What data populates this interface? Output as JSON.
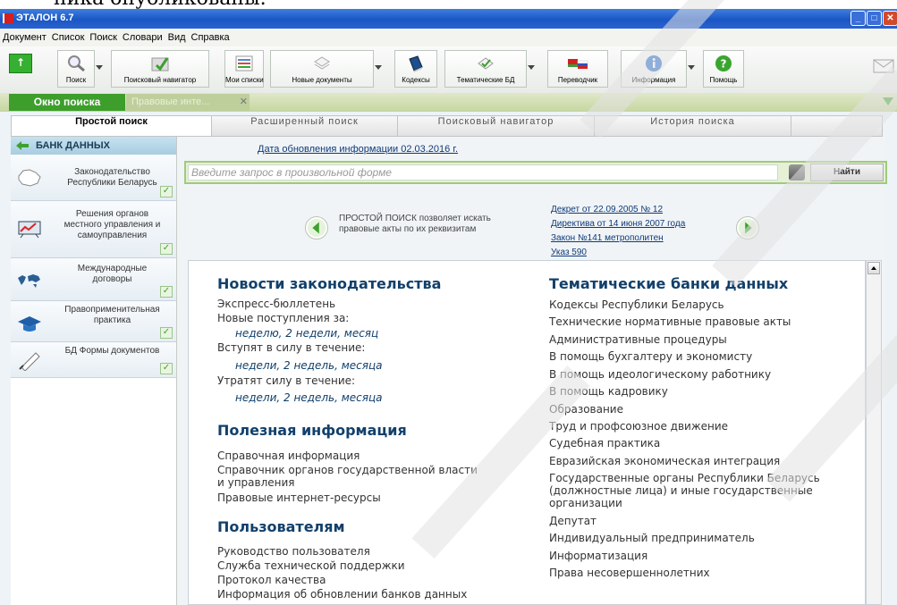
{
  "app": {
    "title": "ЭТАЛОН 6.7",
    "doc_fragment": "ника опубликованы."
  },
  "menu": [
    "Документ",
    "Список",
    "Поиск",
    "Словари",
    "Вид",
    "Справка"
  ],
  "toolbar": [
    {
      "label": "Поиск",
      "icon": "magnifier-icon",
      "dropdown": true
    },
    {
      "label": "Поисковый навигатор",
      "icon": "navigator-icon",
      "dropdown": false
    },
    {
      "label": "Мои списки",
      "icon": "lists-icon",
      "dropdown": false
    },
    {
      "label": "Новые документы",
      "icon": "new-docs-icon",
      "dropdown": true
    },
    {
      "label": "Кодексы",
      "icon": "books-icon",
      "dropdown": false
    },
    {
      "label": "Тематические БД",
      "icon": "thematic-db-icon",
      "dropdown": true
    },
    {
      "label": "Переводчик",
      "icon": "translator-flags-icon",
      "dropdown": false
    },
    {
      "label": "Информация",
      "icon": "info-icon",
      "dropdown": true
    },
    {
      "label": "Помощь",
      "icon": "help-icon",
      "dropdown": false
    }
  ],
  "tabs": {
    "active": "Окно поиска",
    "second": "Правовые инте..."
  },
  "search_tabs": [
    "Простой поиск",
    "Расширенный поиск",
    "Поисковый навигатор",
    "История поиска"
  ],
  "sidebar": {
    "header": "БАНК ДАННЫХ",
    "items": [
      {
        "label": "Законодательство Республики Беларусь",
        "icon": "belarus-map-icon"
      },
      {
        "label": "Решения органов местного управления и самоуправления",
        "icon": "board-chart-icon"
      },
      {
        "label": "Международные договоры",
        "icon": "world-map-icon"
      },
      {
        "label": "Правоприменительная практика",
        "icon": "graduation-cap-icon"
      },
      {
        "label": "БД Формы документов",
        "icon": "pen-document-icon"
      }
    ]
  },
  "main": {
    "update_date": "Дата обновления информации 02.03.2016 г.",
    "search_placeholder": "Введите запрос в произвольной форме",
    "search_value": "",
    "find_button": "Найти",
    "promo_text": "ПРОСТОЙ ПОИСК позволяет искать правовые акты по их реквизитам",
    "example_links": [
      "Декрет от 22.09.2005 № 12",
      "Директива от 14 июня 2007 года",
      "Закон №141 метрополитен",
      "Указ 590"
    ]
  },
  "news": {
    "title": "Новости законодательства",
    "express": "Экспресс-бюллетень",
    "new_arrivals": "Новые поступления за:",
    "new_arrivals_periods": "неделю, 2 недели, месяц",
    "enter_force": "Вступят в силу в течение:",
    "enter_force_periods": "недели, 2 недель, месяца",
    "lose_force": "Утратят силу в течение:",
    "lose_force_periods": "недели, 2 недель, месяца"
  },
  "useful": {
    "title": "Полезная информация",
    "items": [
      "Справочная информация",
      "Справочник органов государственной власти и управления",
      "Правовые интернет-ресурсы"
    ]
  },
  "users": {
    "title": "Пользователям",
    "items": [
      "Руководство пользователя",
      "Служба технической поддержки",
      "Протокол качества",
      "Информация об обновлении банков данных"
    ]
  },
  "thematic": {
    "title": "Тематические банки данных",
    "items": [
      "Кодексы Республики Беларусь",
      "Технические нормативные правовые акты",
      "Административные процедуры",
      "В помощь бухгалтеру и экономисту",
      "В помощь идеологическому работнику",
      "В помощь кадровику",
      "Образование",
      "Труд и профсоюзное движение",
      "Судебная практика",
      "Евразийская экономическая интеграция",
      "Государственные органы Республики Беларусь (должностные лица) и иные государственные организации",
      "Депутат",
      "Индивидуальный предприниматель",
      "Информатизация",
      "Права несовершеннолетних"
    ]
  },
  "colors": {
    "accent_green": "#3d9e2c",
    "heading_blue": "#12406b",
    "link_blue": "#0d3a7a",
    "titlebar_blue": "#1a56c4"
  }
}
